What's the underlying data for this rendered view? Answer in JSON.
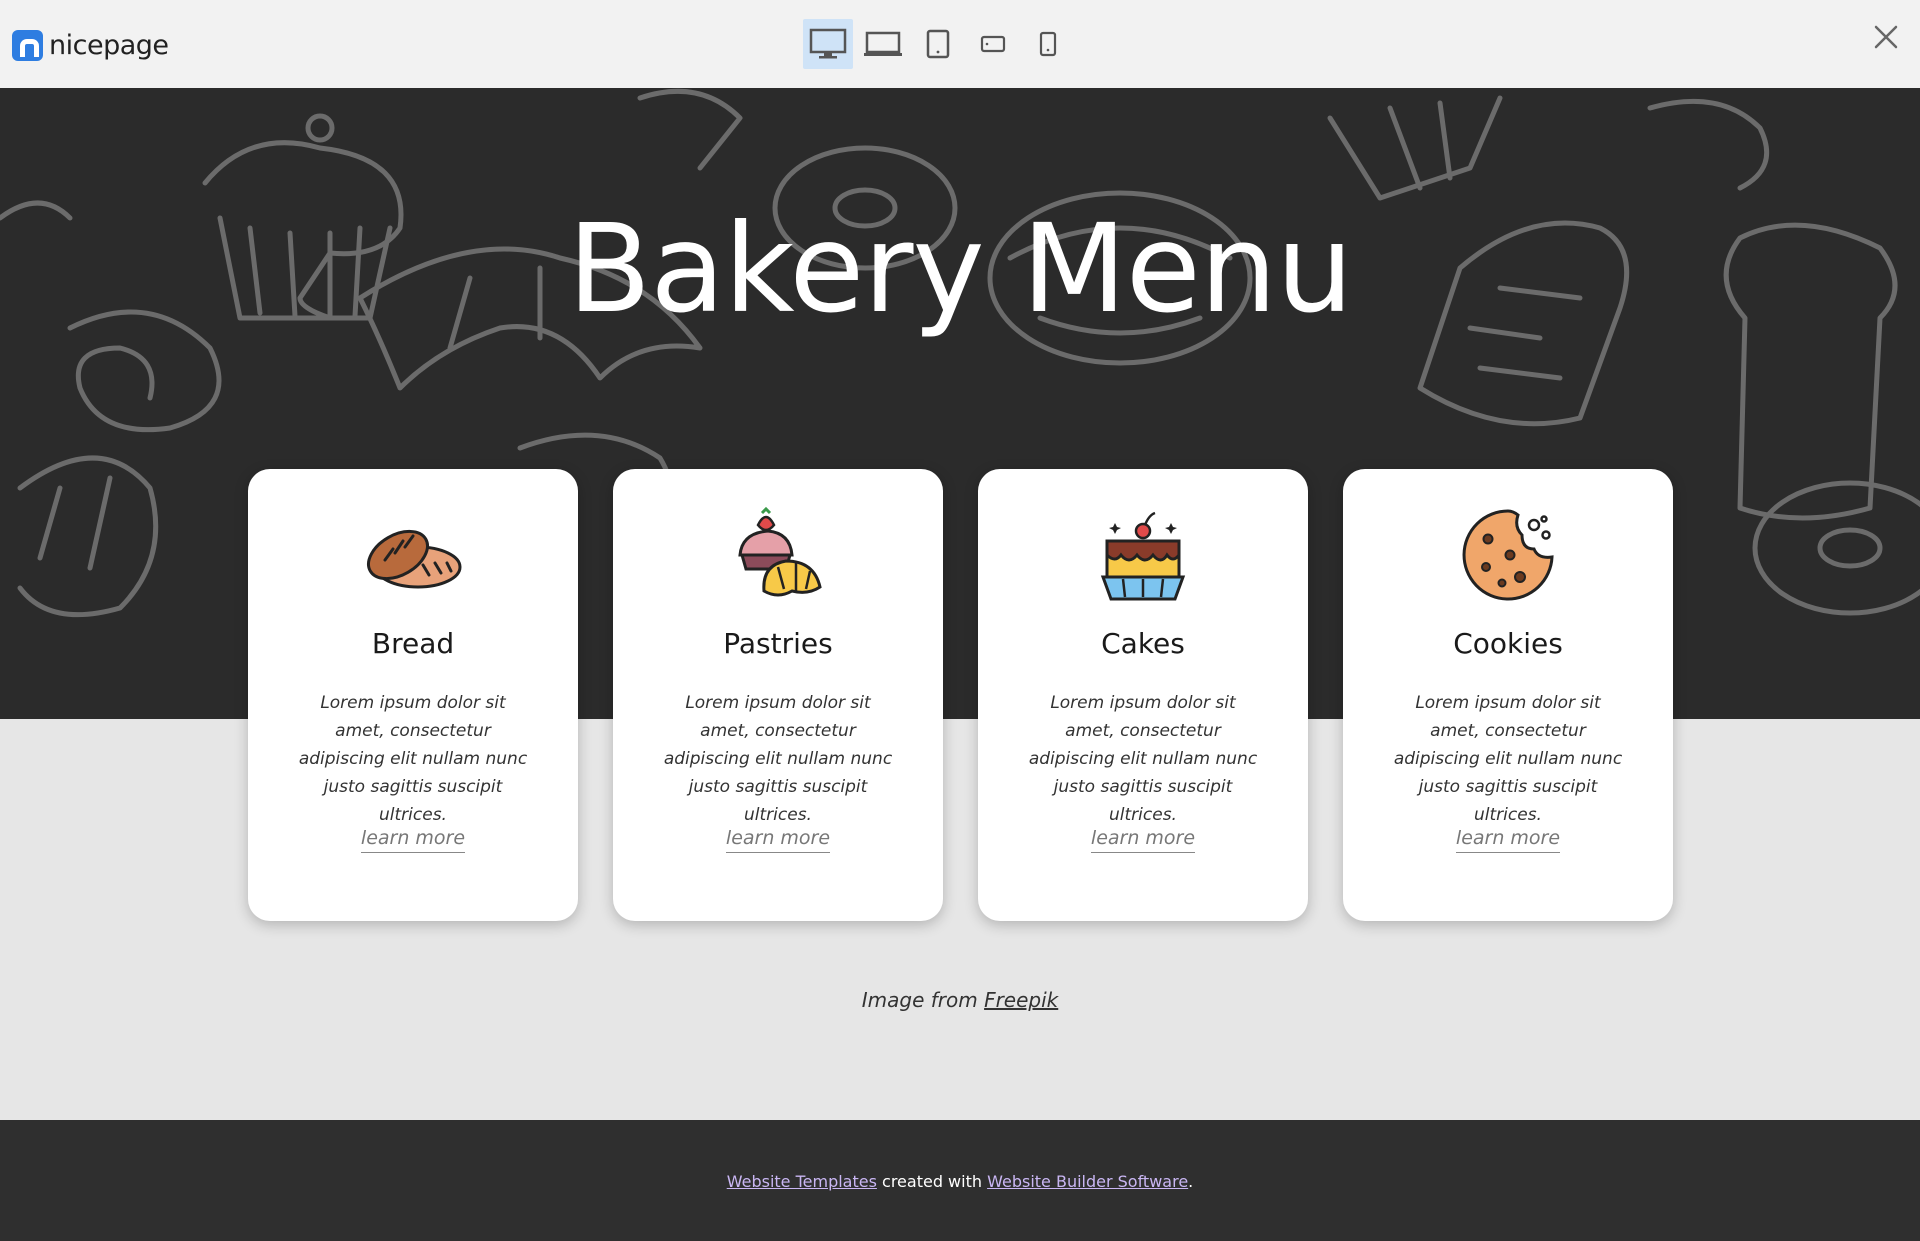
{
  "app": {
    "logo_text": "nicepage"
  },
  "toolbar": {
    "devices": [
      {
        "icon": "desktop-icon",
        "active": true
      },
      {
        "icon": "laptop-icon",
        "active": false
      },
      {
        "icon": "tablet-portrait-icon",
        "active": false
      },
      {
        "icon": "tablet-landscape-icon",
        "active": false
      },
      {
        "icon": "phone-icon",
        "active": false
      }
    ],
    "close_icon": "close-icon"
  },
  "hero": {
    "title": "Bakery Menu"
  },
  "cards": [
    {
      "icon": "bread-icon",
      "title": "Bread",
      "text": "Lorem ipsum dolor sit amet, consectetur adipiscing elit nullam nunc justo sagittis suscipit ultrices.",
      "link": "learn more"
    },
    {
      "icon": "pastries-icon",
      "title": "Pastries",
      "text": "Lorem ipsum dolor sit amet, consectetur adipiscing elit nullam nunc justo sagittis suscipit ultrices.",
      "link": "learn more"
    },
    {
      "icon": "cake-icon",
      "title": "Cakes",
      "text": "Lorem ipsum dolor sit amet, consectetur adipiscing elit nullam nunc justo sagittis suscipit ultrices.",
      "link": "learn more"
    },
    {
      "icon": "cookie-icon",
      "title": "Cookies",
      "text": "Lorem ipsum dolor sit amet, consectetur adipiscing elit nullam nunc justo sagittis suscipit ultrices.",
      "link": "learn more"
    }
  ],
  "credit": {
    "prefix": "Image from ",
    "link": "Freepik"
  },
  "footer": {
    "link1": "Website Templates",
    "middle": " created with ",
    "link2": "Website Builder Software",
    "suffix": "."
  },
  "colors": {
    "accent": "#2e7de1",
    "hero_bg": "#2b2b2b",
    "page_bg": "#e6e6e6",
    "footer_bg": "#2f2f2f",
    "footer_link": "#c9b6f3"
  }
}
